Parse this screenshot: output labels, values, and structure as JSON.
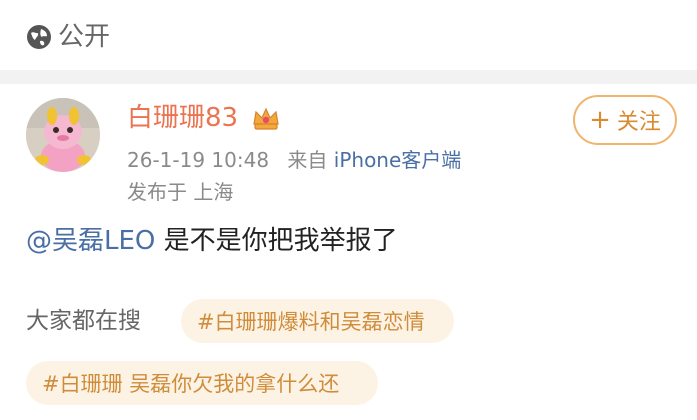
{
  "visibility": {
    "icon": "globe-icon",
    "label": "公开"
  },
  "post": {
    "author": "白珊珊83",
    "badge_icon": "crown-icon",
    "timestamp": "26-1-19 10:48",
    "source_prefix": "来自",
    "source": "iPhone客户端",
    "location": "发布于 上海",
    "follow_label": "关注",
    "mention": "@吴磊LEO",
    "text": " 是不是你把我举报了"
  },
  "search": {
    "label": "大家都在搜",
    "tags": [
      "#白珊珊爆料和吴磊恋情",
      "#白珊珊 吴磊你欠我的拿什么还"
    ]
  },
  "colors": {
    "username": "#eb7350",
    "link": "#4a6fa5",
    "tag_bg": "#fdf3e4",
    "tag_text": "#cf8d3c",
    "follow_border": "#f0b46c"
  }
}
